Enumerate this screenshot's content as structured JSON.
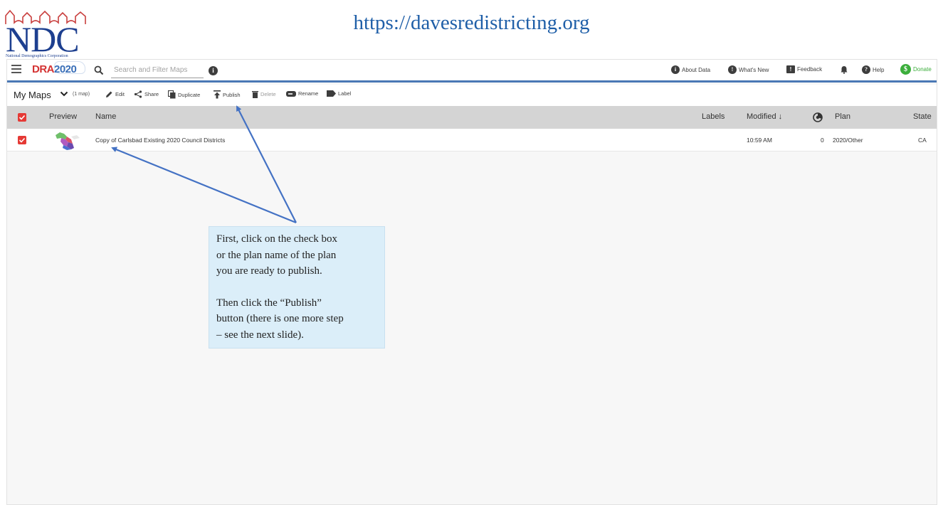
{
  "slide": {
    "logo_text": "NDC",
    "logo_tagline": "National Demographics Corporation",
    "url": "https://davesredistricting.org"
  },
  "header": {
    "brand_red": "DRA",
    "brand_blue": "2020",
    "search_placeholder": "Search and Filter Maps",
    "nav": [
      {
        "label": "About Data",
        "icon": "info-icon"
      },
      {
        "label": "What's New",
        "icon": "megaphone-icon"
      },
      {
        "label": "Feedback",
        "icon": "feedback-icon"
      },
      {
        "label": "",
        "icon": "bell-icon"
      },
      {
        "label": "Help",
        "icon": "help-icon"
      },
      {
        "label": "Donate",
        "icon": "dollar-icon"
      }
    ]
  },
  "toolbar": {
    "title": "My Maps",
    "count": "(1 map)",
    "edit": "Edit",
    "share": "Share",
    "duplicate": "Duplicate",
    "publish": "Publish",
    "delete": "Delete",
    "rename": "Rename",
    "label": "Label"
  },
  "table": {
    "columns": {
      "preview": "Preview",
      "name": "Name",
      "labels": "Labels",
      "modified": "Modified ↓",
      "plan": "Plan",
      "state": "State"
    },
    "rows": [
      {
        "name": "Copy of Carlsbad Existing 2020 Council Districts",
        "labels": "",
        "modified": "10:59 AM",
        "count": "0",
        "plan": "2020/Other",
        "state": "CA"
      }
    ]
  },
  "annotation": {
    "line1": "First, click on the check box",
    "line2": "or the plan name of the plan",
    "line3": "you are ready to publish.",
    "line4": "Then click the “Publish”",
    "line5": "button (there is one more step",
    "line6": "– see the next slide)."
  },
  "colors": {
    "logo_blue": "#1d3f8f",
    "logo_red": "#c9403f",
    "accent_red": "#e53935",
    "header_underline": "#4a78b5",
    "donate_green": "#3cae3c",
    "arrow_blue": "#4472c4",
    "callout_bg": "#dbeef9"
  }
}
